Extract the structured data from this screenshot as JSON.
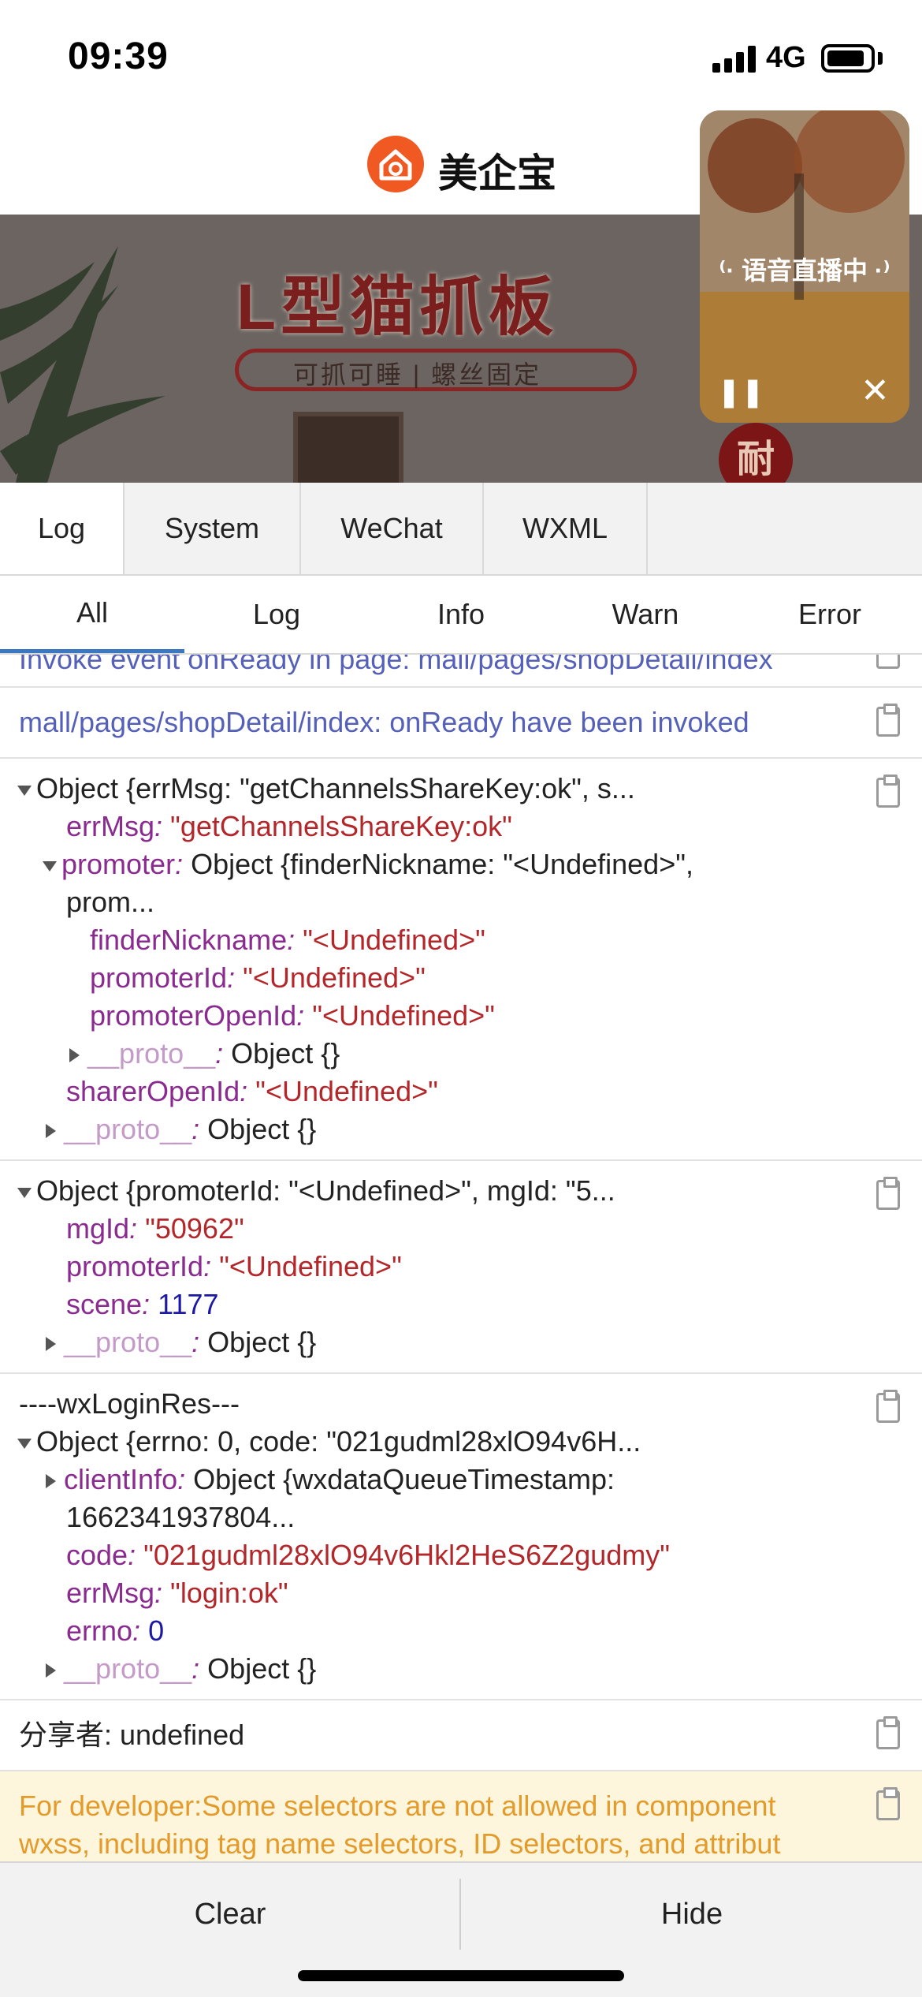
{
  "status_bar": {
    "time": "09:39",
    "network": "4G"
  },
  "app": {
    "title": "美企宝"
  },
  "banner": {
    "title": "L型猫抓板",
    "subtitle": "可抓可睡 | 螺丝固定",
    "badge": "耐"
  },
  "live": {
    "label": "⁽· 语音直播中 ·⁾"
  },
  "panel_tabs": [
    "Log",
    "System",
    "WeChat",
    "WXML"
  ],
  "filter_tabs": [
    "All",
    "Log",
    "Info",
    "Warn",
    "Error"
  ],
  "logs": {
    "e1": "Invoke event onReady in page: mall/pages/shopDetail/index",
    "e2": "mall/pages/shopDetail/index: onReady have been invoked",
    "o1": {
      "summary": "Object {errMsg: \"getChannelsShareKey:ok\", s...",
      "errMsg_key": "errMsg",
      "errMsg_val": "\"getChannelsShareKey:ok\"",
      "promoter_key": "promoter",
      "promoter_summary": "Object {finderNickname: \"<Undefined>\",",
      "promoter_summary2": "prom...",
      "finder_key": "finderNickname",
      "finder_val": "\"<Undefined>\"",
      "pid_key": "promoterId",
      "pid_val": "\"<Undefined>\"",
      "popen_key": "promoterOpenId",
      "popen_val": "\"<Undefined>\"",
      "sharer_key": "sharerOpenId",
      "sharer_val": "\"<Undefined>\""
    },
    "o2": {
      "summary": "Object {promoterId: \"<Undefined>\", mgId: \"5...",
      "mgId_key": "mgId",
      "mgId_val": "\"50962\"",
      "pid_key": "promoterId",
      "pid_val": "\"<Undefined>\"",
      "scene_key": "scene",
      "scene_val": "1177"
    },
    "o3": {
      "label": "----wxLoginRes---",
      "summary": "Object {errno: 0, code: \"021gudml28xlO94v6H...",
      "client_key": "clientInfo",
      "client_summary": "Object {wxdataQueueTimestamp:",
      "client_summary2": "1662341937804...",
      "code_key": "code",
      "code_val": "\"021gudml28xlO94v6Hkl2HeS6Z2gudmy\"",
      "errmsg_key": "errMsg",
      "errmsg_val": "\"login:ok\"",
      "errno_key": "errno",
      "errno_val": "0"
    },
    "proto_key": "__proto__",
    "proto_val": "Object {}",
    "sep": ":",
    "sharer_line": "分享者: undefined",
    "warn_line1": "For developer:Some selectors are not allowed in component",
    "warn_line2": "wxss, including tag name selectors, ID selectors, and attribut"
  },
  "footer": {
    "clear": "Clear",
    "hide": "Hide"
  }
}
